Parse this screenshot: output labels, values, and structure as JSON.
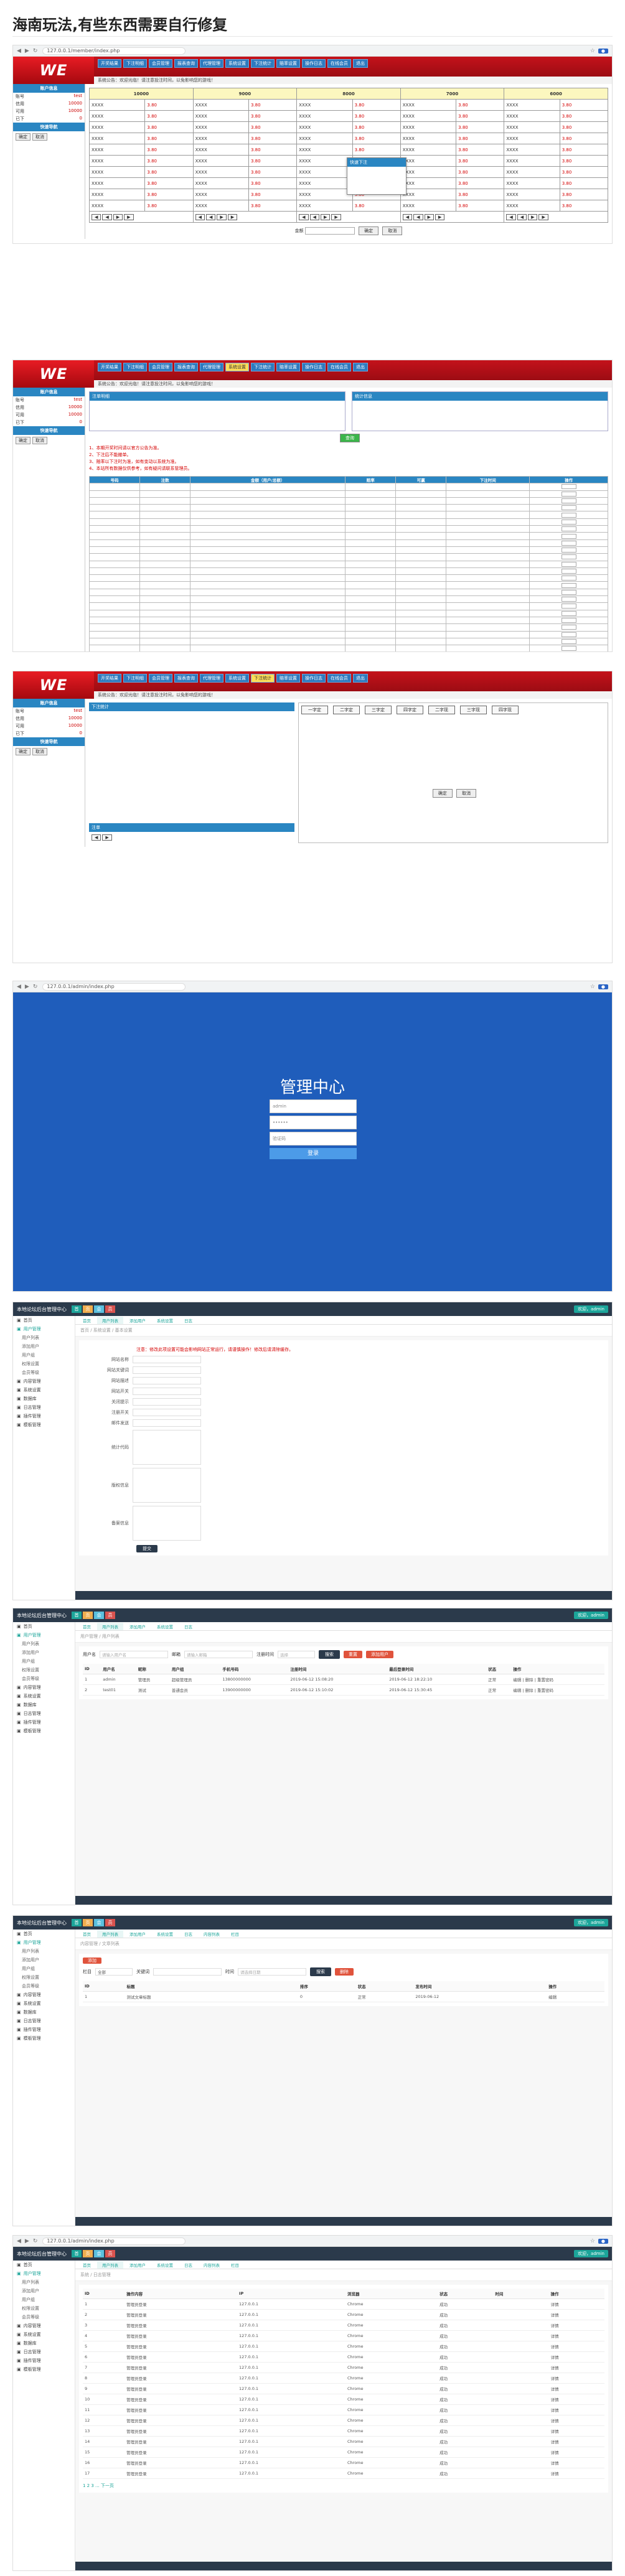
{
  "page": {
    "title": "海南玩法,有些东西需要自行修复"
  },
  "browser": {
    "url1": "127.0.0.1/member/index.php",
    "url2": "127.0.0.1/admin/index.php"
  },
  "we": {
    "logo": "WE",
    "menu": [
      "开奖结果",
      "下注明细",
      "会员管理",
      "报表查询",
      "代理管理",
      "系统设置",
      "下注统计",
      "赔率设置",
      "操作日志",
      "在线会员",
      "退出"
    ],
    "sub": "系统公告：欢迎光临！请注意投注时间，以免影响您的游戏！",
    "side_head_1": "账户信息",
    "side_head_2": "快速导航",
    "side_rows": [
      {
        "k": "账号",
        "v": "test"
      },
      {
        "k": "信用",
        "v": "10000"
      },
      {
        "k": "可用",
        "v": "10000"
      },
      {
        "k": "已下",
        "v": "0"
      }
    ],
    "side_btns": [
      "确定",
      "取消"
    ]
  },
  "shot1": {
    "headers": [
      "10000",
      "9000",
      "8000",
      "7000",
      "6000"
    ],
    "rows": [
      [
        "XXXX",
        "3.80",
        "XXXX",
        "3.80",
        "XXXX",
        "3.80",
        "XXXX",
        "3.80",
        "XXXX",
        "3.80"
      ],
      [
        "XXXX",
        "3.80",
        "XXXX",
        "3.80",
        "XXXX",
        "3.80",
        "XXXX",
        "3.80",
        "XXXX",
        "3.80"
      ],
      [
        "XXXX",
        "3.80",
        "XXXX",
        "3.80",
        "XXXX",
        "3.80",
        "XXXX",
        "3.80",
        "XXXX",
        "3.80"
      ],
      [
        "XXXX",
        "3.80",
        "XXXX",
        "3.80",
        "XXXX",
        "3.80",
        "XXXX",
        "3.80",
        "XXXX",
        "3.80"
      ],
      [
        "XXXX",
        "3.80",
        "XXXX",
        "3.80",
        "XXXX",
        "3.80",
        "XXXX",
        "3.80",
        "XXXX",
        "3.80"
      ],
      [
        "XXXX",
        "3.80",
        "XXXX",
        "3.80",
        "XXXX",
        "3.80",
        "XXXX",
        "3.80",
        "XXXX",
        "3.80"
      ],
      [
        "XXXX",
        "3.80",
        "XXXX",
        "3.80",
        "XXXX",
        "3.80",
        "XXXX",
        "3.80",
        "XXXX",
        "3.80"
      ],
      [
        "XXXX",
        "3.80",
        "XXXX",
        "3.80",
        "XXXX",
        "3.80",
        "XXXX",
        "3.80",
        "XXXX",
        "3.80"
      ],
      [
        "XXXX",
        "3.80",
        "XXXX",
        "3.80",
        "XXXX",
        "3.80",
        "XXXX",
        "3.80",
        "XXXX",
        "3.80"
      ],
      [
        "XXXX",
        "3.80",
        "XXXX",
        "3.80",
        "XXXX",
        "3.80",
        "XXXX",
        "3.80",
        "XXXX",
        "3.80"
      ]
    ],
    "popup_title": "快速下注",
    "amount_label": "金额",
    "confirm": "确定",
    "cancel": "取消"
  },
  "shot2": {
    "box_left": "注单明细",
    "box_right": "统计信息",
    "notes": [
      "1、本期开奖时间请以官方公告为准。",
      "2、下注后不能撤单。",
      "3、赔率以下注时为准，如有变动以系统为准。",
      "4、本站所有数据仅供参考，如有疑问请联系管理员。"
    ],
    "tbl_head": [
      "号码",
      "注数",
      "金额（用户/总额）",
      "赔率",
      "可赢",
      "下注时间",
      "操作"
    ],
    "row_count": 32,
    "btn": "查询"
  },
  "shot3": {
    "center_title": "下注统计",
    "tabs": [
      "一字定",
      "二字定",
      "三字定",
      "四字定",
      "二字现",
      "三字现",
      "四字现"
    ],
    "bottom_head": "注单",
    "ok": "确定",
    "cancel": "取消"
  },
  "shot4": {
    "title": "管理中心",
    "user_ph": "admin",
    "pwd_ph": "••••••",
    "captcha_ph": "验证码",
    "login_btn": "登录"
  },
  "admin": {
    "brand": "本地论坛后台管理中心",
    "chips": [
      "首",
      "页",
      "会",
      "员"
    ],
    "chip_colors": [
      "#1ca59a",
      "#f0ad4e",
      "#5bc0de",
      "#d9534f"
    ],
    "user": "欢迎，admin",
    "menu": [
      "首页",
      "用户管理",
      "内容管理",
      "系统设置",
      "数据库",
      "日志管理",
      "插件管理",
      "模板管理"
    ],
    "submenu": [
      "用户列表",
      "添加用户",
      "用户组",
      "权限设置",
      "会员等级"
    ]
  },
  "shot5": {
    "tabs": [
      "首页",
      "用户列表",
      "添加用户",
      "系统设置",
      "日志"
    ],
    "crumb": "首页 / 系统设置 / 基本设置",
    "warn": "注意：修改此项设置可能会影响网站正常运行，请谨慎操作！修改后请清除缓存。",
    "labels": [
      "网站名称",
      "网站关键词",
      "网站描述",
      "网站开关",
      "关闭提示",
      "注册开关",
      "邮件发送",
      "统计代码",
      "版权信息",
      "备案信息"
    ],
    "submit": "提交"
  },
  "shot6": {
    "tabs": [
      "首页",
      "用户列表",
      "添加用户",
      "系统设置",
      "日志"
    ],
    "crumb": "用户管理 / 用户列表",
    "f_name": "用户名",
    "f_name_ph": "请输入用户名",
    "f_email": "邮箱",
    "f_email_ph": "请输入邮箱",
    "f_time": "注册时间",
    "f_time_ph": "选择",
    "search": "搜索",
    "reset": "重置",
    "add": "添加用户",
    "head": [
      "ID",
      "用户名",
      "昵称",
      "用户组",
      "手机号码",
      "注册时间",
      "最后登录时间",
      "状态",
      "操作"
    ],
    "rows": [
      [
        "1",
        "admin",
        "管理员",
        "超级管理员",
        "13800000000",
        "2019-06-12 15:08:20",
        "2019-06-12 18:22:10",
        "正常",
        "编辑 | 删除 | 重置密码"
      ],
      [
        "2",
        "test01",
        "测试",
        "普通会员",
        "13900000000",
        "2019-06-12 15:10:02",
        "2019-06-12 15:30:45",
        "正常",
        "编辑 | 删除 | 重置密码"
      ]
    ]
  },
  "shot7": {
    "tabs": [
      "首页",
      "用户列表",
      "添加用户",
      "系统设置",
      "日志",
      "内容列表",
      "栏目"
    ],
    "crumb": "内容管理 / 文章列表",
    "f_cat": "栏目",
    "f_cat_val": "全部",
    "f_kw": "关键词",
    "f_date": "时间",
    "f_date_ph": "请选择日期",
    "search": "搜索",
    "del": "删除",
    "add": "添加",
    "head": [
      "ID",
      "标题",
      "",
      "",
      "排序",
      "状态",
      "发布时间",
      "操作"
    ],
    "row": [
      "1",
      "测试文章标题",
      "",
      "",
      "0",
      "正常",
      "2019-06-12",
      "编辑"
    ]
  },
  "shot8": {
    "tabs": [
      "首页",
      "用户列表",
      "添加用户",
      "系统设置",
      "日志",
      "内容列表",
      "栏目"
    ],
    "crumb": "系统 / 日志管理",
    "head": [
      "ID",
      "操作内容",
      "IP",
      "浏览器",
      "状态",
      "时间",
      "操作"
    ],
    "ip": "127.0.0.1",
    "browser": "Chrome",
    "status": "成功",
    "op": "管理员登录",
    "action": "详情",
    "rows": 17,
    "pager": "1 2 3 ... 下一页"
  }
}
